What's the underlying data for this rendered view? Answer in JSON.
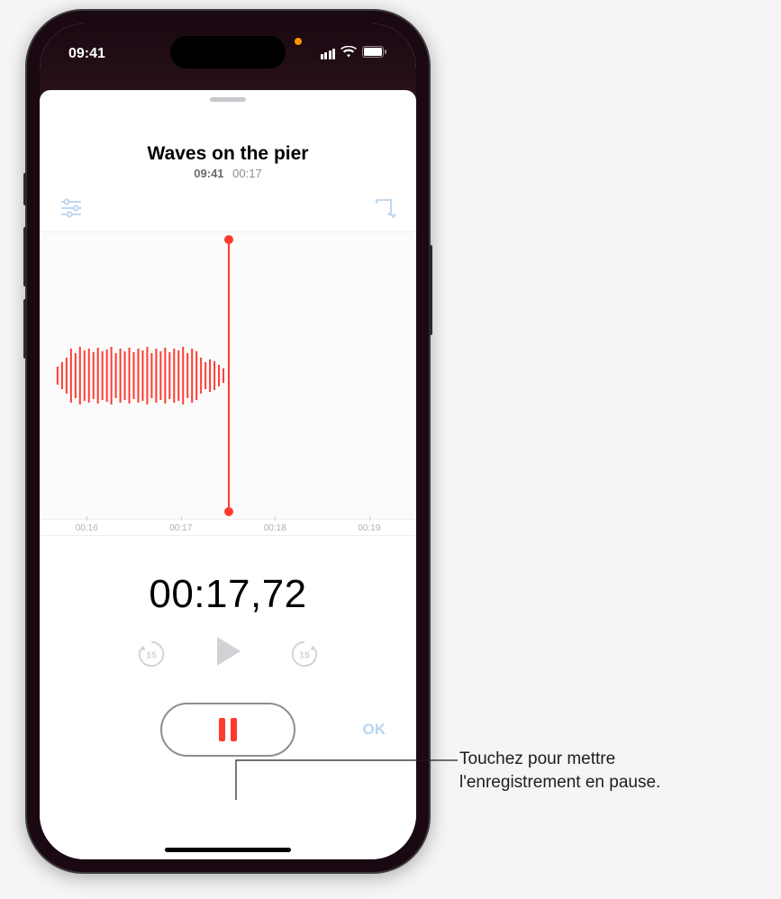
{
  "statusbar": {
    "time": "09:41"
  },
  "recording": {
    "title": "Waves on the pier",
    "sub_time": "09:41",
    "sub_dur": "00:17"
  },
  "ruler": {
    "t1": "00:16",
    "t2": "00:17",
    "t3": "00:18",
    "t4": "00:19"
  },
  "timer": "00:17,72",
  "skip_back_label": "15",
  "skip_fwd_label": "15",
  "ok_label": "OK",
  "callout": {
    "line1": "Touchez pour mettre",
    "line2": "l'enregistrement en pause."
  }
}
